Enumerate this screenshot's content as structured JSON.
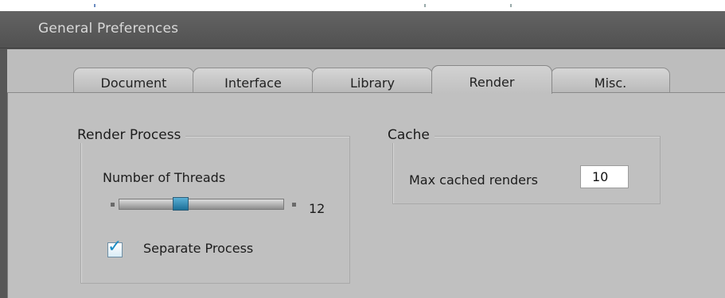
{
  "window": {
    "title": "General Preferences"
  },
  "tabs": [
    {
      "label": "Document"
    },
    {
      "label": "Interface"
    },
    {
      "label": "Library"
    },
    {
      "label": "Render"
    },
    {
      "label": "Misc."
    }
  ],
  "active_tab": "Render",
  "render_process": {
    "legend": "Render Process",
    "threads_label": "Number of Threads",
    "threads_value": "12",
    "threads_level_fraction": 0.38,
    "separate_process_label": "Separate Process",
    "separate_process_checked": true
  },
  "cache": {
    "legend": "Cache",
    "max_cached_label": "Max cached renders",
    "max_cached_value": "10"
  },
  "colors": {
    "title_bar": "#575757",
    "panel": "#c0c0c0",
    "slider_thumb": "#2e8bb8",
    "checkmark": "#1a8cc4"
  }
}
